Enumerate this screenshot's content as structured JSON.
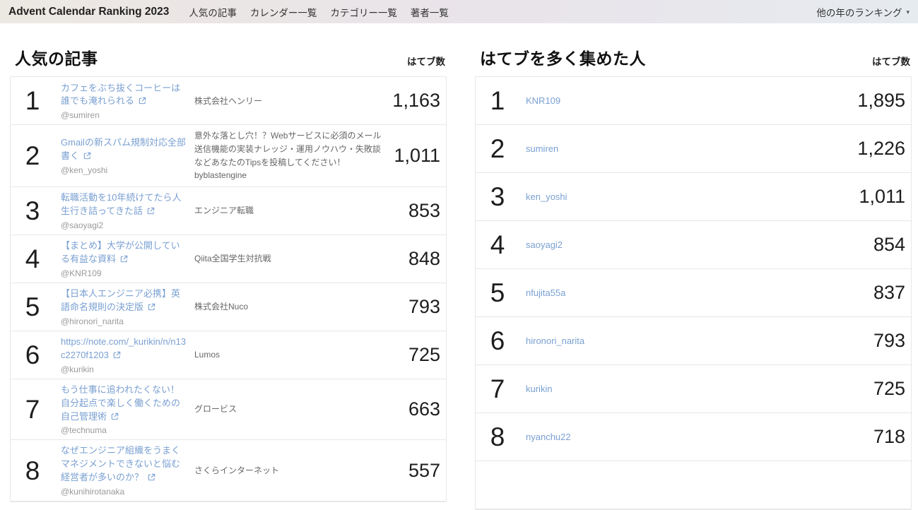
{
  "navbar": {
    "brand": "Advent Calendar Ranking 2023",
    "items": [
      "人気の記事",
      "カレンダー一覧",
      "カテゴリー一覧",
      "著者一覧"
    ],
    "year_dropdown": "他の年のランキング",
    "caret_icon": "▾"
  },
  "colors": {
    "link_blue": "#7aa0d2",
    "navbar_gradient_left": "#ece8e2",
    "navbar_gradient_right": "#e6ebef",
    "table_border": "#e7e7e7",
    "rank_text": "#1d1d1d",
    "muted_text": "#9a9a9a"
  },
  "popular_articles": {
    "title": "人気の記事",
    "count_header": "はてブ数",
    "rows": [
      {
        "rank": "1",
        "title": "カフェをぶち抜くコーヒーは誰でも淹れられる",
        "author": "@sumiren",
        "calendar": "株式会社ヘンリー",
        "count": "1,163"
      },
      {
        "rank": "2",
        "title": "Gmailの新スパム規制対応全部書く",
        "author": "@ken_yoshi",
        "calendar": "意外な落とし穴！？Webサービスに必須のメール送信機能の実装ナレッジ・運用ノウハウ・失敗談などあなたのTipsを投稿してください！byblastengine",
        "count": "1,011"
      },
      {
        "rank": "3",
        "title": "転職活動を10年続けてたら人生行き詰ってきた話",
        "author": "@saoyagi2",
        "calendar": "エンジニア転職",
        "count": "853"
      },
      {
        "rank": "4",
        "title": "【まとめ】大学が公開している有益な資料",
        "author": "@KNR109",
        "calendar": "Qiita全国学生対抗戦",
        "count": "848"
      },
      {
        "rank": "5",
        "title": "【日本人エンジニア必携】英語命名規則の決定版",
        "author": "@hironori_narita",
        "calendar": "株式会社Nuco",
        "count": "793"
      },
      {
        "rank": "6",
        "title": "https://note.com/_kurikin/n/n13c2270f1203",
        "author": "@kurikin",
        "calendar": "Lumos",
        "count": "725"
      },
      {
        "rank": "7",
        "title": "もう仕事に追われたくない！自分起点で楽しく働くための自己管理術",
        "author": "@technuma",
        "calendar": "グロービス",
        "count": "663"
      },
      {
        "rank": "8",
        "title": "なぜエンジニア組織をうまくマネジメントできないと悩む経営者が多いのか？",
        "author": "@kunihirotanaka",
        "calendar": "さくらインターネット",
        "count": "557"
      }
    ]
  },
  "top_users": {
    "title": "はてブを多く集めた人",
    "count_header": "はてブ数",
    "rows": [
      {
        "rank": "1",
        "name": "KNR109",
        "count": "1,895"
      },
      {
        "rank": "2",
        "name": "sumiren",
        "count": "1,226"
      },
      {
        "rank": "3",
        "name": "ken_yoshi",
        "count": "1,011"
      },
      {
        "rank": "4",
        "name": "saoyagi2",
        "count": "854"
      },
      {
        "rank": "5",
        "name": "nfujita55a",
        "count": "837"
      },
      {
        "rank": "6",
        "name": "hironori_narita",
        "count": "793"
      },
      {
        "rank": "7",
        "name": "kurikin",
        "count": "725"
      },
      {
        "rank": "8",
        "name": "nyanchu22",
        "count": "718"
      }
    ]
  }
}
